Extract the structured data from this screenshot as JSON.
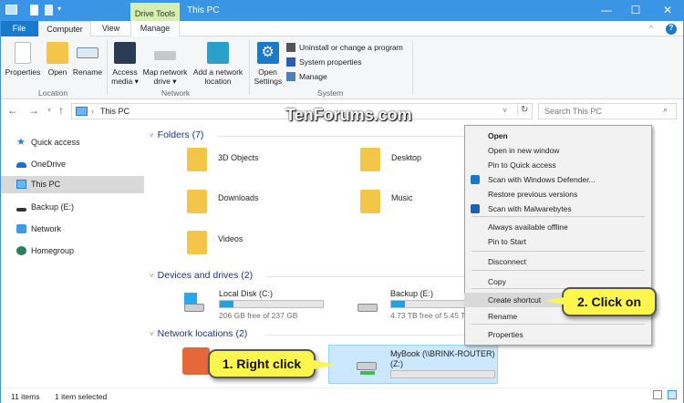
{
  "titlebar": {
    "context_tab": "Drive Tools",
    "title": "This PC",
    "minimize": "—",
    "maximize": "☐",
    "close": "✕"
  },
  "tabs": [
    "File",
    "Computer",
    "View",
    "Manage"
  ],
  "ribbon": {
    "location": {
      "label": "Location",
      "buttons": [
        "Properties",
        "Open",
        "Rename"
      ]
    },
    "network": {
      "label": "Network",
      "buttons": [
        "Access media ▾",
        "Map network drive ▾",
        "Add a network location"
      ]
    },
    "system": {
      "label": "System",
      "open_settings": "Open Settings",
      "links": [
        "Uninstall or change a program",
        "System properties",
        "Manage"
      ]
    }
  },
  "address": {
    "path": "This PC",
    "search_placeholder": "Search This PC"
  },
  "watermark": "TenForums.com",
  "nav": [
    "Quick access",
    "OneDrive",
    "This PC",
    "Backup (E:)",
    "Network",
    "Homegroup"
  ],
  "sections": {
    "folders": {
      "title": "Folders (7)",
      "items": [
        "3D Objects",
        "Desktop",
        "Downloads",
        "Music",
        "Videos"
      ]
    },
    "drives": {
      "title": "Devices and drives (2)",
      "items": [
        {
          "name": "Local Disk (C:)",
          "free": "206 GB free of 237 GB",
          "used_fraction": 0.13
        },
        {
          "name": "Backup (E:)",
          "free": "4.73 TB free of 5.45 TB",
          "used_fraction": 0.13
        }
      ]
    },
    "network": {
      "title": "Network locations (2)",
      "items": [
        {
          "name": "MyBook (\\\\BRINK-ROUTER)",
          "drive": "(Z:)",
          "used_fraction": 0
        }
      ]
    }
  },
  "context_menu": [
    "Open",
    "Open in new window",
    "Pin to Quick access",
    "Scan with Windows Defender...",
    "Restore previous versions",
    "Scan with Malwarebytes",
    "Always available offline",
    "Pin to Start",
    "Disconnect",
    "Copy",
    "Create shortcut",
    "Rename",
    "Properties"
  ],
  "callouts": {
    "one": "1. Right click",
    "two": "2. Click on"
  },
  "status": {
    "count": "11 items",
    "selected": "1 item selected"
  }
}
